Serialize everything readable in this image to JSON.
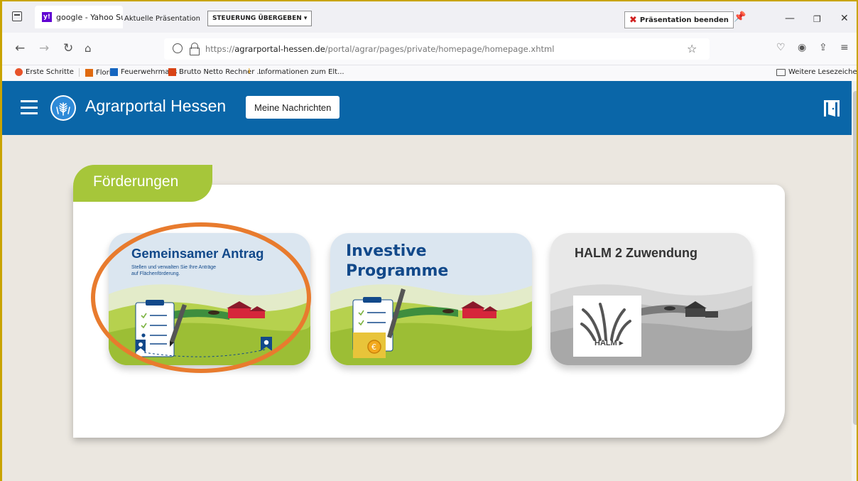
{
  "browser": {
    "tab": {
      "label": "google - Yahoo Such",
      "favicon": "yahoo-favicon"
    },
    "presentation": {
      "current_label": "Aktuelle Präsentation",
      "handover_label": "STEUERUNG ÜBERGEBEN ▾",
      "end_label": "Präsentation beenden"
    },
    "url": {
      "prefix": "https://",
      "domain": "agrarportal-hessen.de",
      "path": "/portal/agrar/pages/private/homepage/homepage.xhtml"
    },
    "bookmarks": [
      "Erste Schritte",
      "Florix",
      "Feuerwehrmails",
      "Brutto Netto Rechner ...",
      "Informationen zum Elt..."
    ],
    "other_bookmarks": "Weitere Lesezeichen"
  },
  "app": {
    "title": "Agrarportal Hessen",
    "messages_button": "Meine Nachrichten",
    "colors": {
      "header": "#0a66a8",
      "accent": "#a6c63a",
      "tile_title": "#12498a",
      "highlight": "#e87b2e"
    }
  },
  "section": {
    "title": "Förderungen",
    "tiles": [
      {
        "title": "Gemeinsamer Antrag",
        "subtitle_line1": "Stellen und verwalten Sie Ihre Anträge",
        "subtitle_line2": "auf Flächenförderung."
      },
      {
        "title_line1": "Investive",
        "title_line2": "Programme"
      },
      {
        "title": "HALM 2 Zuwendung",
        "logo_text": "HALM"
      }
    ]
  }
}
